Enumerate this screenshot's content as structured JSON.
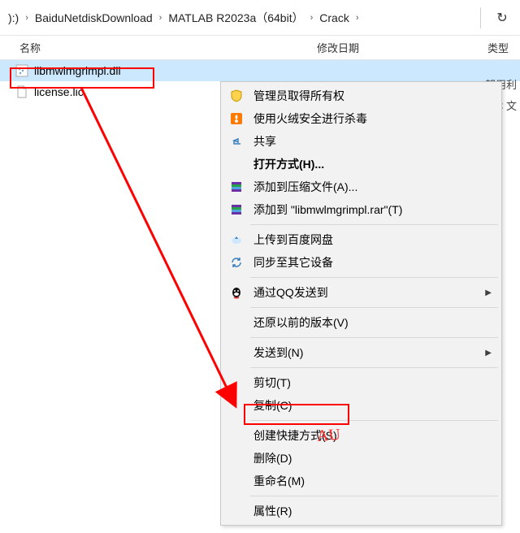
{
  "breadcrumb": {
    "seg0": "):)",
    "seg1": "BaiduNetdiskDownload",
    "seg2": "MATLAB R2023a（64bit）",
    "seg3": "Crack"
  },
  "columns": {
    "name": "名称",
    "date": "修改日期",
    "type": "类型"
  },
  "files": {
    "f0": "libmwlmgrimpl.dll",
    "f1": "license.lic"
  },
  "side": {
    "s0": "卽用利",
    "s1": "C 文"
  },
  "menu": {
    "adminOwn": "管理员取得所有权",
    "huorong": "使用火绒安全进行杀毒",
    "share": "共享",
    "openWith": "打开方式(H)...",
    "addArchive": "添加到压缩文件(A)...",
    "addRar": "添加到 \"libmwlmgrimpl.rar\"(T)",
    "uploadBaidu": "上传到百度网盘",
    "syncDevices": "同步至其它设备",
    "sendQQ": "通过QQ发送到",
    "restore": "还原以前的版本(V)",
    "sendTo": "发送到(N)",
    "cut": "剪切(T)",
    "copy": "复制(C)",
    "shortcut": "创建快捷方式(S)",
    "delete": "删除(D)",
    "rename": "重命名(M)",
    "props": "属性(R)"
  },
  "watermark": "AU"
}
